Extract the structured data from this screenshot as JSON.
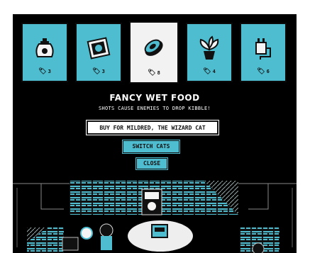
{
  "shop": {
    "items": [
      {
        "icon": "potion-bag-icon",
        "price": "3",
        "selected": false
      },
      {
        "icon": "framed-picture-icon",
        "price": "3",
        "selected": false
      },
      {
        "icon": "wet-food-can-icon",
        "price": "8",
        "selected": true
      },
      {
        "icon": "potted-plant-icon",
        "price": "4",
        "selected": false
      },
      {
        "icon": "power-plug-icon",
        "price": "6",
        "selected": false
      }
    ],
    "currency_icon": "kibble-tag-icon",
    "item_title": "FANCY WET FOOD",
    "item_description": "SHOTS CAUSE ENEMIES TO DROP KIBBLE!",
    "buy_label": "BUY FOR MILDRED, THE WIZARD CAT",
    "switch_label": "SWITCH CATS",
    "close_label": "CLOSE"
  },
  "colors": {
    "accent": "#4fbdd0",
    "background": "#000000",
    "selected_card": "#f2f2f2",
    "text": "#ffffff"
  }
}
